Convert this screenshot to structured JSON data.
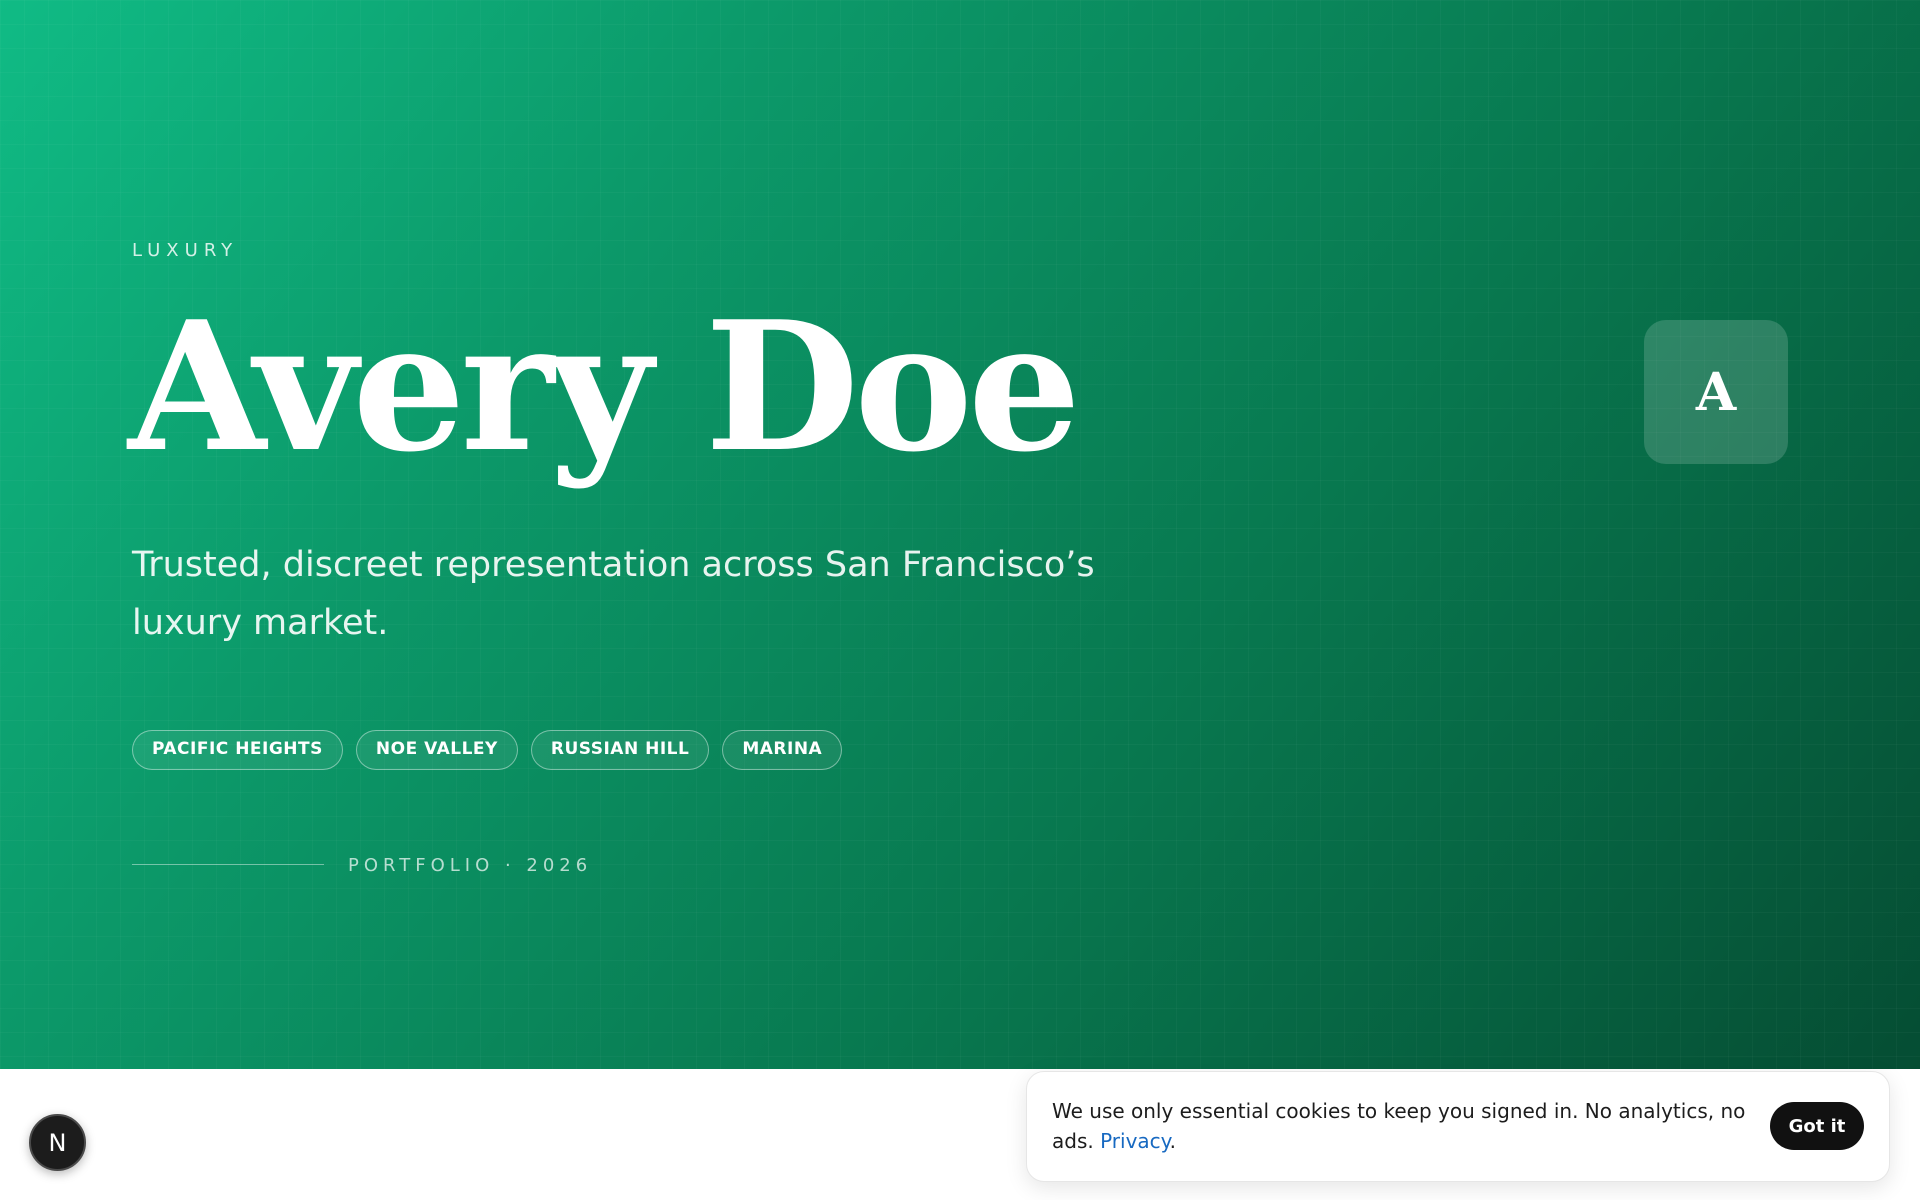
{
  "colors": {
    "hero_gradient_start": "#10bb85",
    "hero_gradient_end": "#054d33",
    "accent_link": "#1769c1",
    "button_dark": "#111111"
  },
  "hero": {
    "eyebrow": "LUXURY",
    "name": "Avery Doe",
    "tagline": "Trusted, discreet representation across San Francisco’s luxury market.",
    "neighborhoods": [
      "PACIFIC HEIGHTS",
      "NOE VALLEY",
      "RUSSIAN HILL",
      "MARINA"
    ],
    "footline": "PORTFOLIO · 2026",
    "monogram": "A"
  },
  "dev_badge": {
    "letter": "N",
    "icon": "nextjs-logo-icon"
  },
  "cookie_banner": {
    "message": "We use only essential cookies to keep you signed in. No analytics, no ads.",
    "link_label": "Privacy",
    "link_suffix": ".",
    "button_label": "Got it"
  }
}
